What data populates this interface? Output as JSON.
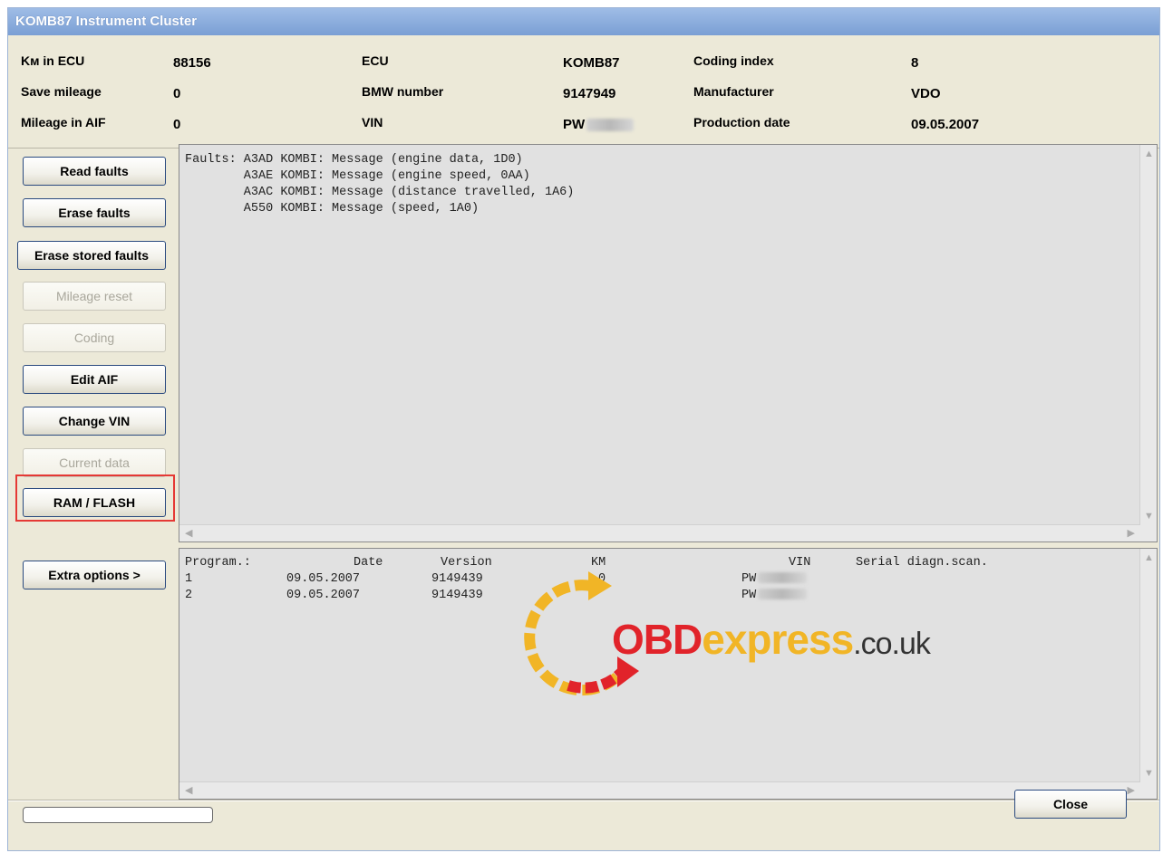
{
  "window": {
    "title": "KOMB87 Instrument Cluster"
  },
  "info": {
    "km_in_ecu_label": "Kм in ECU",
    "km_in_ecu_value": "88156",
    "save_mileage_label": "Save mileage",
    "save_mileage_value": "0",
    "mileage_aif_label": "Mileage in AIF",
    "mileage_aif_value": "0",
    "ecu_label": "ECU",
    "ecu_value": "KOMB87",
    "bmw_number_label": "BMW number",
    "bmw_number_value": "9147949",
    "vin_label": "VIN",
    "vin_value": "PW",
    "coding_index_label": "Coding index",
    "coding_index_value": "8",
    "manufacturer_label": "Manufacturer",
    "manufacturer_value": "VDO",
    "production_date_label": "Production date",
    "production_date_value": "09.05.2007"
  },
  "buttons": {
    "read_faults": "Read faults",
    "erase_faults": "Erase faults",
    "erase_stored_faults": "Erase stored faults",
    "mileage_reset": "Mileage reset",
    "coding": "Coding",
    "edit_aif": "Edit AIF",
    "change_vin": "Change VIN",
    "current_data": "Current data",
    "ram_flash": "RAM / FLASH",
    "extra_options": "Extra options >",
    "close": "Close"
  },
  "faults_text": "Faults: A3AD KOMBI: Message (engine data, 1D0)\n        A3AE KOMBI: Message (engine speed, 0AA)\n        A3AC KOMBI: Message (distance travelled, 1A6)\n        A550 KOMBI: Message (speed, 1A0)",
  "program_table": {
    "headers": [
      "Program.:",
      "Date",
      "Version",
      "KM",
      "VIN",
      "Serial diagn.scan."
    ],
    "rows": [
      [
        "1",
        "09.05.2007",
        "9149439",
        "0",
        "PW",
        ""
      ],
      [
        "2",
        "09.05.2007",
        "9149439",
        "",
        "PW",
        ""
      ]
    ]
  },
  "watermark": {
    "brand_red": "OBD",
    "brand_yellow": "express",
    "domain": ".co.uk"
  },
  "colors": {
    "highlight": "#e53935",
    "title_bar": "#7a9fd4"
  }
}
